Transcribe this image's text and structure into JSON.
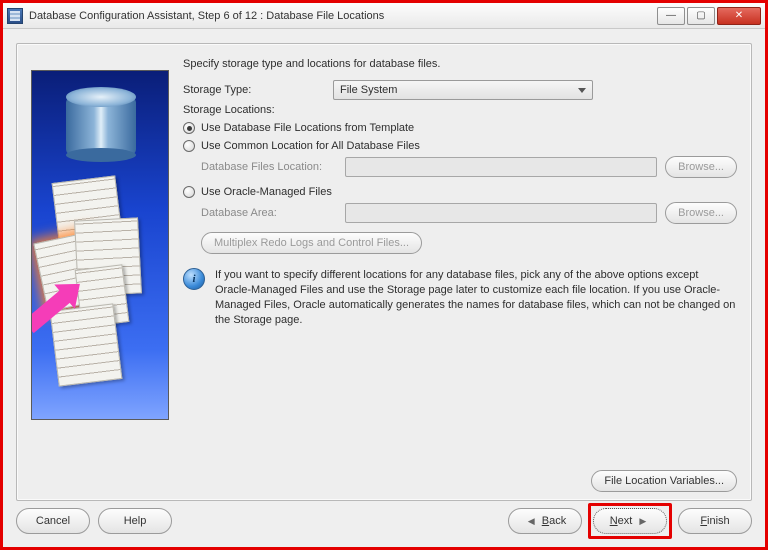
{
  "window": {
    "title": "Database Configuration Assistant, Step 6 of 12 : Database File Locations"
  },
  "heading": "Specify storage type and locations for database files.",
  "storage_type": {
    "label": "Storage Type:",
    "value": "File System"
  },
  "storage_locations_label": "Storage Locations:",
  "options": {
    "from_template": {
      "label": "Use Database File Locations from Template",
      "selected": true
    },
    "common_location": {
      "label": "Use Common Location for All Database Files",
      "selected": false,
      "field_label": "Database Files Location:",
      "field_value": "",
      "browse": "Browse..."
    },
    "omf": {
      "label": "Use Oracle-Managed Files",
      "selected": false,
      "field_label": "Database Area:",
      "field_value": "",
      "browse": "Browse..."
    }
  },
  "multiplex_button": "Multiplex Redo Logs and Control Files...",
  "info": "If you want to specify different locations for any database files, pick any of the above options except Oracle-Managed Files and use the Storage page later to customize each file location. If you use Oracle-Managed Files, Oracle automatically generates the names for database files, which can not be changed on the Storage page.",
  "file_location_vars": "File Location Variables...",
  "buttons": {
    "cancel": "Cancel",
    "help": "Help",
    "back": "Back",
    "next": "Next",
    "finish": "Finish"
  }
}
